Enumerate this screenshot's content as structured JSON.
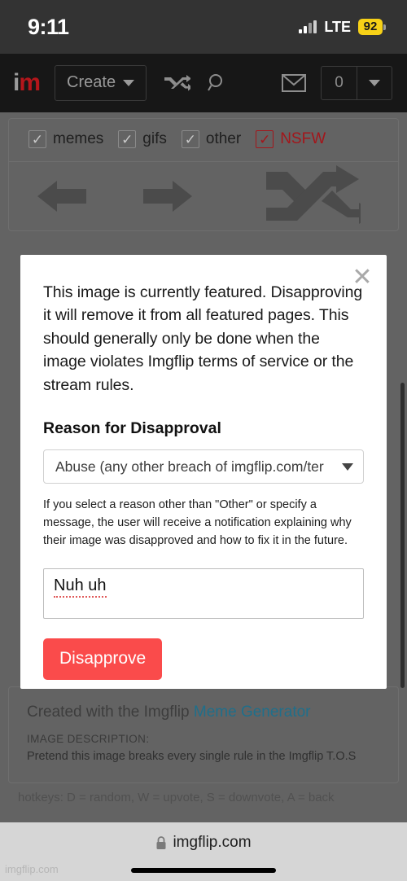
{
  "status_bar": {
    "time": "9:11",
    "network": "LTE",
    "battery": "92",
    "signal_icon": "signal-bars-icon",
    "battery_icon": "battery-icon"
  },
  "navbar": {
    "logo_i": "i",
    "logo_m": "m",
    "create_label": "Create",
    "shuffle_icon": "shuffle-icon",
    "search_icon": "search-icon",
    "mail_icon": "envelope-icon",
    "notification_count": "0",
    "caret_icon": "chevron-down-icon"
  },
  "filters": {
    "items": [
      {
        "label": "memes",
        "checked": true,
        "nsfw": false
      },
      {
        "label": "gifs",
        "checked": true,
        "nsfw": false
      },
      {
        "label": "other",
        "checked": true,
        "nsfw": false
      },
      {
        "label": "NSFW",
        "checked": true,
        "nsfw": true
      }
    ],
    "check_glyph": "✓"
  },
  "nav_arrows": {
    "prev_icon": "arrow-left-icon",
    "next_icon": "arrow-right-icon",
    "shuffle_icon": "shuffle-icon"
  },
  "modal": {
    "close_icon": "close-icon",
    "body_text": "This image is currently featured. Disapproving it will remove it from all featured pages. This should generally only be done when the image violates Imgflip terms of service or the stream rules.",
    "heading": "Reason for Disapproval",
    "select_value": "Abuse (any other breach of imgflip.com/ter",
    "select_caret_icon": "chevron-down-icon",
    "helper_text": "If you select a reason other than \"Other\" or specify a message, the user will receive a notification explaining why their image was disapproved and how to fix it in the future.",
    "message_value": "Nuh uh",
    "message_placeholder": "",
    "submit_label": "Disapprove",
    "submit_color": "#fa4b4b"
  },
  "credit": {
    "prefix": "Created with the Imgflip ",
    "link_label": "Meme Generator",
    "description_label": "IMAGE DESCRIPTION:",
    "description_text": "Pretend this image breaks every single rule in the Imgflip T.O.S",
    "cut_off_line": "       hotkeys:  D = random,  W = upvote,  S = downvote,  A = back"
  },
  "browser": {
    "lock_icon": "lock-icon",
    "url": "imgflip.com",
    "watermark": "imgflip.com"
  }
}
